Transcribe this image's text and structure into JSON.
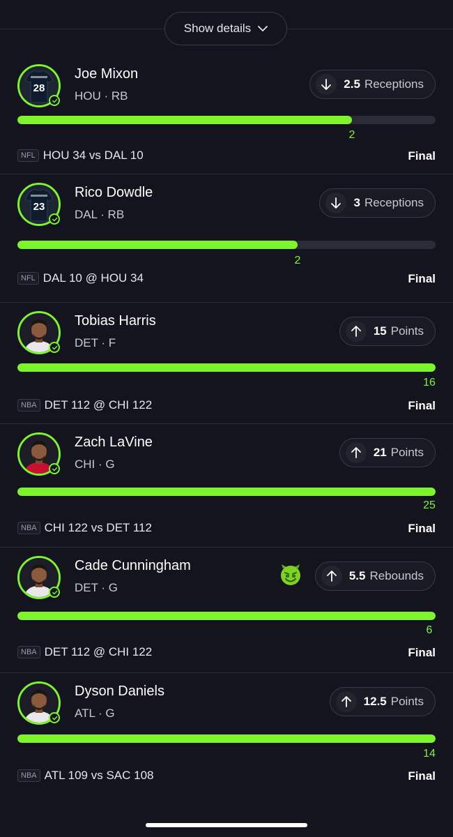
{
  "header": {
    "show_details_label": "Show details"
  },
  "colors": {
    "accent": "#7cf52b",
    "background": "#14141e",
    "track": "#2c2c38"
  },
  "picks": [
    {
      "name": "Joe Mixon",
      "meta": "HOU · RB",
      "avatar_type": "jersey",
      "jersey_number": "28",
      "direction": "down",
      "line": "2.5",
      "stat": "Receptions",
      "actual": "2",
      "progress": 0.8,
      "league": "NFL",
      "matchup": "HOU 34 vs DAL 10",
      "status": "Final",
      "emoji": ""
    },
    {
      "name": "Rico Dowdle",
      "meta": "DAL · RB",
      "avatar_type": "jersey",
      "jersey_number": "23",
      "direction": "down",
      "line": "3",
      "stat": "Receptions",
      "actual": "2",
      "progress": 0.67,
      "league": "NFL",
      "matchup": "DAL 10 @ HOU 34",
      "status": "Final",
      "emoji": ""
    },
    {
      "name": "Tobias Harris",
      "meta": "DET · F",
      "avatar_type": "headshot",
      "jersey_number": "",
      "direction": "up",
      "line": "15",
      "stat": "Points",
      "actual": "16",
      "progress": 1.0,
      "league": "NBA",
      "matchup": "DET 112 @ CHI 122",
      "status": "Final",
      "emoji": ""
    },
    {
      "name": "Zach LaVine",
      "meta": "CHI · G",
      "avatar_type": "headshot",
      "jersey_number": "",
      "direction": "up",
      "line": "21",
      "stat": "Points",
      "actual": "25",
      "progress": 1.0,
      "league": "NBA",
      "matchup": "CHI 122 vs DET 112",
      "status": "Final",
      "emoji": ""
    },
    {
      "name": "Cade Cunningham",
      "meta": "DET · G",
      "avatar_type": "headshot",
      "jersey_number": "",
      "direction": "up",
      "line": "5.5",
      "stat": "Rebounds",
      "actual": "6",
      "progress": 1.0,
      "league": "NBA",
      "matchup": "DET 112 @ CHI 122",
      "status": "Final",
      "emoji": "green-devil-money-face-icon"
    },
    {
      "name": "Dyson Daniels",
      "meta": "ATL · G",
      "avatar_type": "headshot",
      "jersey_number": "",
      "direction": "up",
      "line": "12.5",
      "stat": "Points",
      "actual": "14",
      "progress": 1.0,
      "league": "NBA",
      "matchup": "ATL 109 vs SAC 108",
      "status": "Final",
      "emoji": ""
    }
  ]
}
